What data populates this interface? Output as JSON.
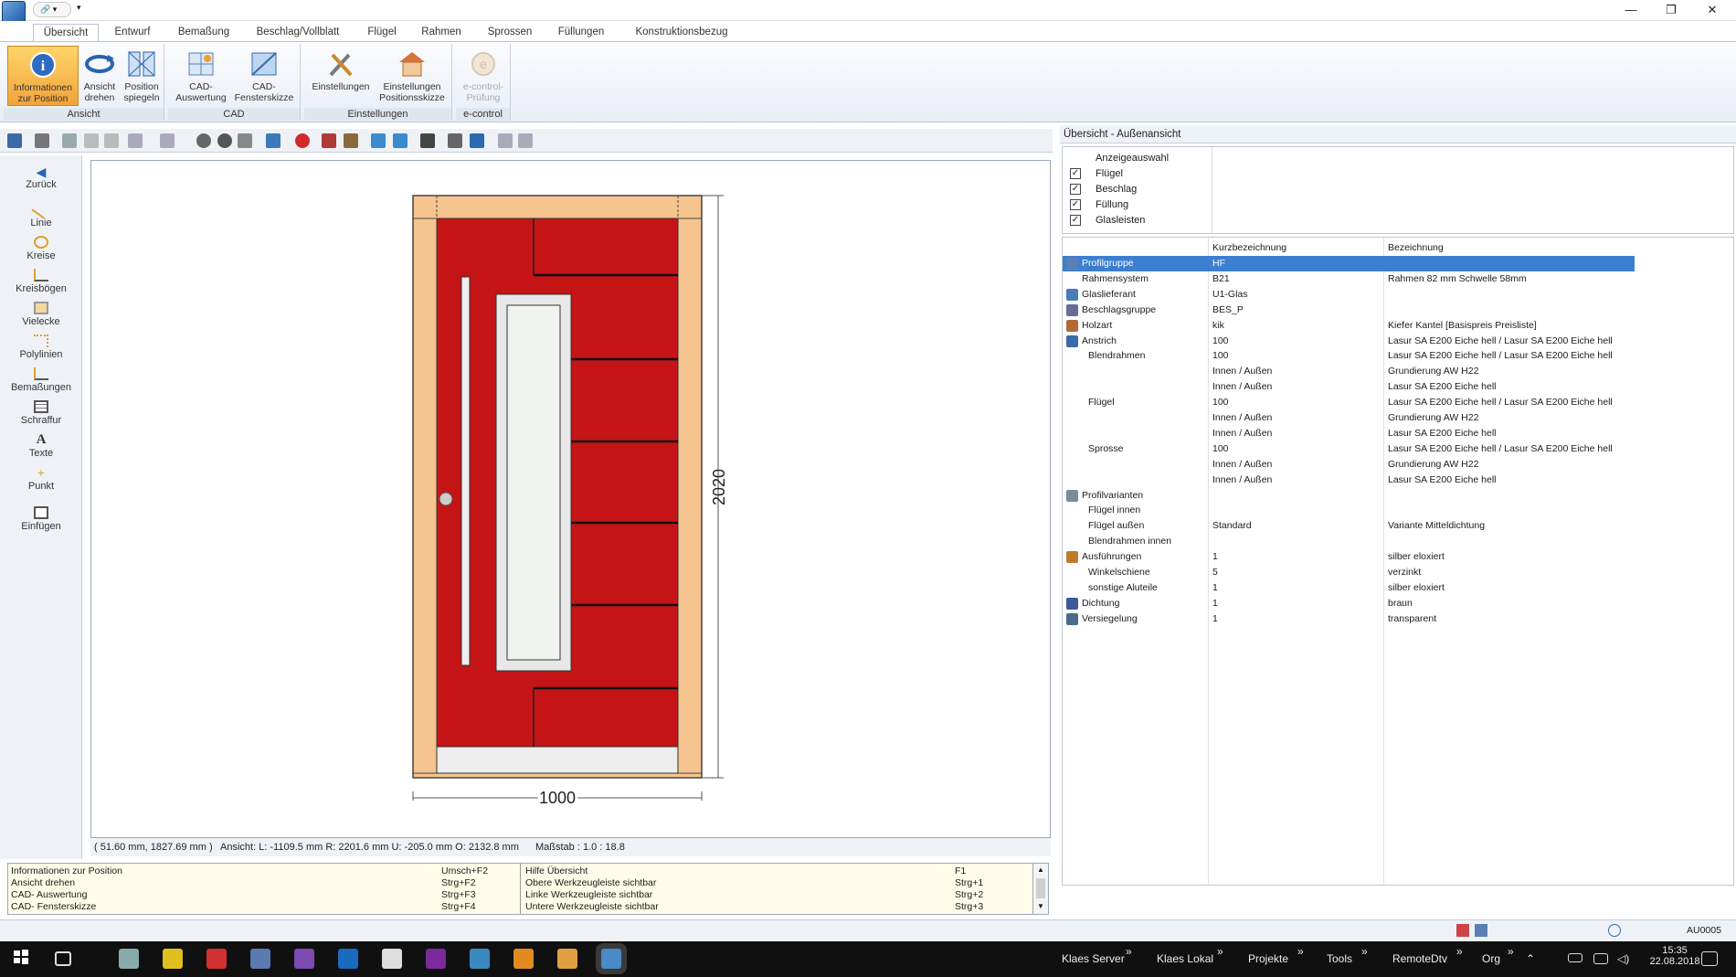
{
  "window": {
    "qat_label": "🔗 ▾",
    "minimize": "—",
    "restore": "❐",
    "close": "✕"
  },
  "tabs": [
    "Übersicht",
    "Entwurf",
    "Bemaßung",
    "Beschlag/Vollblatt",
    "Flügel",
    "Rahmen",
    "Sprossen",
    "Füllungen",
    "Konstruktionsbezug"
  ],
  "ribbon": {
    "groups": {
      "ansicht": "Ansicht",
      "cad": "CAD",
      "einstellungen": "Einstellungen",
      "econtrol": "e-control"
    },
    "buttons": {
      "info": "Informationen zur Position",
      "drehen": "Ansicht drehen",
      "spiegeln": "Position spiegeln",
      "cad_auswertung": "CAD-Auswertung",
      "cad_skizze": "CAD-Fensterskizze",
      "einstellungen": "Einstellungen",
      "einst_pos": "Einstellungen Positionsskizze",
      "econtrol": "e-control-Prüfung"
    }
  },
  "left_tools": [
    "Zurück",
    "Linie",
    "Kreise",
    "Kreisbögen",
    "Vielecke",
    "Polylinien",
    "Bemaßungen",
    "Schraffur",
    "Texte",
    "Punkt",
    "Einfügen"
  ],
  "drawing": {
    "height_dim": "2020",
    "width_dim": "1000"
  },
  "status": {
    "coords": "( 51.60 mm, 1827.69 mm )",
    "ansicht": "Ansicht:  L: -1109.5 mm     R: 2201.6 mm     U: -205.0 mm     O: 2132.8 mm",
    "massstab": "Maßstab : 1.0 : 18.8"
  },
  "help": [
    {
      "left": "Informationen zur Position",
      "key1": "Umsch+F2",
      "right": "Hilfe Übersicht",
      "key2": "F1"
    },
    {
      "left": "Ansicht drehen",
      "key1": "Strg+F2",
      "right": "Obere Werkzeugleiste sichtbar",
      "key2": "Strg+1"
    },
    {
      "left": "CAD- Auswertung",
      "key1": "Strg+F3",
      "right": "Linke Werkzeugleiste sichtbar",
      "key2": "Strg+2"
    },
    {
      "left": "CAD- Fensterskizze",
      "key1": "Strg+F4",
      "right": "Untere Werkzeugleiste sichtbar",
      "key2": "Strg+3"
    }
  ],
  "panel": {
    "title": "Übersicht - Außenansicht",
    "anzeige_header": "Anzeigeauswahl",
    "anzeige": [
      "Flügel",
      "Beschlag",
      "Füllung",
      "Glasleisten"
    ],
    "col_kurz": "Kurzbezeichnung",
    "col_bez": "Bezeichnung",
    "rows": [
      {
        "name": "Profilgruppe",
        "kurz": "HF",
        "bez": "",
        "icon": "#5b7fb5",
        "indent": 0,
        "sel": true
      },
      {
        "name": "Rahmensystem",
        "kurz": "B21",
        "bez": "Rahmen 82 mm Schwelle     58mm",
        "icon": "",
        "indent": 0
      },
      {
        "name": "Glaslieferant",
        "kurz": "U1-Glas",
        "bez": "",
        "icon": "#4a7ab8",
        "indent": 0
      },
      {
        "name": "Beschlagsgruppe",
        "kurz": "BES_P",
        "bez": "",
        "icon": "#6b6b9a",
        "indent": 0
      },
      {
        "name": "Holzart",
        "kurz": "kik",
        "bez": "Kiefer Kantel [Basispreis Preisliste]",
        "icon": "#b06a3a",
        "indent": 0
      },
      {
        "name": "Anstrich",
        "kurz": "100",
        "bez": "Lasur SA E200 Eiche hell / Lasur SA E200 Eiche hell",
        "icon": "#3a6aa8",
        "indent": 0
      },
      {
        "name": "Blendrahmen",
        "kurz": "100",
        "bez": "Lasur SA E200 Eiche hell / Lasur SA E200 Eiche hell",
        "icon": "",
        "indent": 1
      },
      {
        "name": "",
        "kurz": "Innen / Außen",
        "bez": "Grundierung AW H22",
        "icon": "",
        "indent": 1
      },
      {
        "name": "",
        "kurz": "Innen / Außen",
        "bez": "Lasur SA E200 Eiche hell",
        "icon": "",
        "indent": 1
      },
      {
        "name": "Flügel",
        "kurz": "100",
        "bez": "Lasur SA E200 Eiche hell / Lasur SA E200 Eiche hell",
        "icon": "",
        "indent": 1
      },
      {
        "name": "",
        "kurz": "Innen / Außen",
        "bez": "Grundierung AW H22",
        "icon": "",
        "indent": 1
      },
      {
        "name": "",
        "kurz": "Innen / Außen",
        "bez": "Lasur SA E200 Eiche hell",
        "icon": "",
        "indent": 1
      },
      {
        "name": "Sprosse",
        "kurz": "100",
        "bez": "Lasur SA E200 Eiche hell / Lasur SA E200 Eiche hell",
        "icon": "",
        "indent": 1
      },
      {
        "name": "",
        "kurz": "Innen / Außen",
        "bez": "Grundierung AW H22",
        "icon": "",
        "indent": 1
      },
      {
        "name": "",
        "kurz": "Innen / Außen",
        "bez": "Lasur SA E200 Eiche hell",
        "icon": "",
        "indent": 1
      },
      {
        "name": "Profilvarianten",
        "kurz": "",
        "bez": "",
        "icon": "#7a8aa0",
        "indent": 0
      },
      {
        "name": "Flügel innen",
        "kurz": "",
        "bez": "",
        "icon": "",
        "indent": 1
      },
      {
        "name": "Flügel außen",
        "kurz": "Standard",
        "bez": "Variante Mitteldichtung",
        "icon": "",
        "indent": 1
      },
      {
        "name": "Blendrahmen innen",
        "kurz": "",
        "bez": "",
        "icon": "",
        "indent": 1
      },
      {
        "name": "Ausführungen",
        "kurz": "1",
        "bez": "silber eloxiert",
        "icon": "#c07a2a",
        "indent": 0
      },
      {
        "name": "Winkelschiene",
        "kurz": "5",
        "bez": "verzinkt",
        "icon": "",
        "indent": 1
      },
      {
        "name": "sonstige Aluteile",
        "kurz": "1",
        "bez": "silber eloxiert",
        "icon": "",
        "indent": 1
      },
      {
        "name": "Dichtung",
        "kurz": "1",
        "bez": "braun",
        "icon": "#3a5a9a",
        "indent": 0
      },
      {
        "name": "Versiegelung",
        "kurz": "1",
        "bez": "transparent",
        "icon": "#4a6a8a",
        "indent": 0
      }
    ]
  },
  "bottom_status": "AU0005",
  "taskbar": {
    "links": [
      "Klaes Server",
      "Klaes Lokal",
      "Projekte",
      "Tools",
      "RemoteDtv",
      "Org"
    ],
    "time": "15:35",
    "date": "22.08.2018"
  }
}
